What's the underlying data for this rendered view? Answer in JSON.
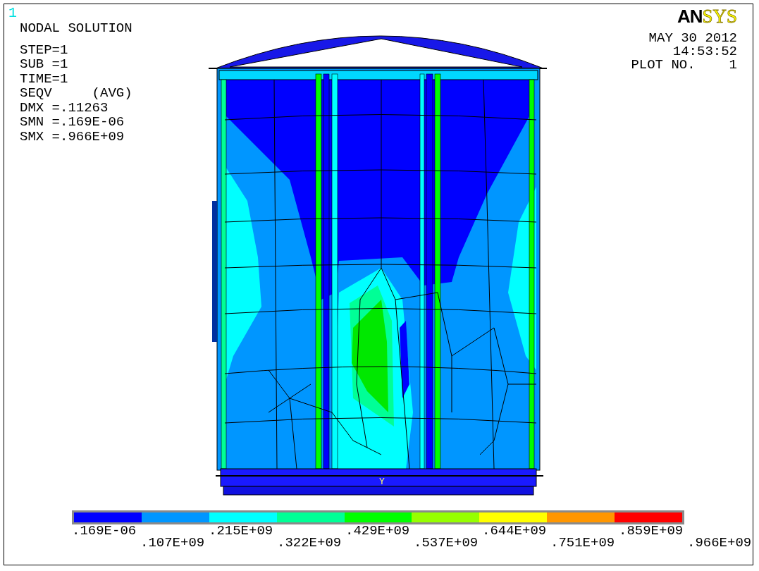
{
  "window_number": "1",
  "title": "NODAL SOLUTION",
  "info_lines": [
    "STEP=1",
    "SUB =1",
    "TIME=1",
    "SEQV     (AVG)",
    "DMX =.11263",
    "SMN =.169E-06",
    "SMX =.966E+09"
  ],
  "logo": {
    "bold": "AN",
    "light": "SYS"
  },
  "date": "MAY 30 2012",
  "time": "14:53:52",
  "plot_label": "PLOT NO.",
  "plot_number": "1",
  "triad_label": "Y",
  "legend": {
    "bands": [
      {
        "color": "#0000ff"
      },
      {
        "color": "#0096ff"
      },
      {
        "color": "#00ffff"
      },
      {
        "color": "#00ff96"
      },
      {
        "color": "#00ff00"
      },
      {
        "color": "#96ff00"
      },
      {
        "color": "#ffff00"
      },
      {
        "color": "#ff9600"
      },
      {
        "color": "#ff0000"
      }
    ],
    "ticks": [
      ".169E-06",
      ".107E+09",
      ".215E+09",
      ".322E+09",
      ".429E+09",
      ".537E+09",
      ".644E+09",
      ".751E+09",
      ".859E+09",
      ".966E+09"
    ]
  }
}
